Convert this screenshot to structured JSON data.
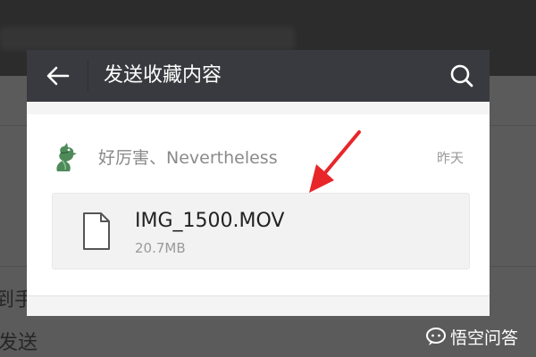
{
  "header": {
    "title": "发送收藏内容"
  },
  "favorite_item": {
    "sender": "好厉害、Nevertheless",
    "date": "昨天",
    "file": {
      "name": "IMG_1500.MOV",
      "size": "20.7MB"
    }
  },
  "background": {
    "text_left_1": "到手",
    "text_left_2": "发送"
  },
  "watermark": {
    "text": "悟空问答"
  },
  "icons": {
    "back": "back-arrow-icon",
    "search": "search-icon",
    "file": "file-document-icon",
    "avatar": "dragon-avatar-icon",
    "annotation": "red-arrow-icon"
  },
  "colors": {
    "titlebar": "#393a3f",
    "annotation_arrow": "#e8262a",
    "sheet_bg": "#f4f4f4"
  }
}
